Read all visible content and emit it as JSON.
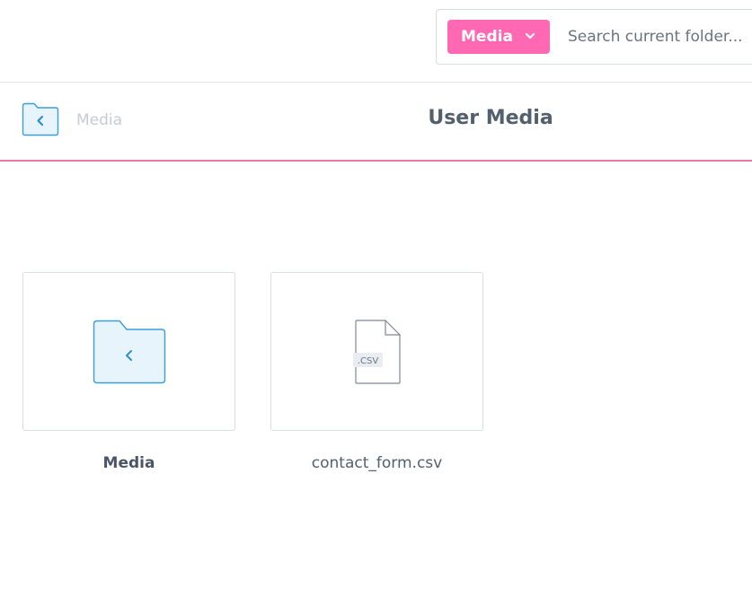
{
  "toolbar": {
    "scope_dropdown_label": "Media",
    "search_placeholder": "Search current folder..."
  },
  "header": {
    "breadcrumb_parent": "Media",
    "title": "User Media"
  },
  "items": [
    {
      "name": "Media",
      "type": "folder",
      "icon": "folder-back-icon"
    },
    {
      "name": "contact_form.csv",
      "type": "file",
      "icon": "csv-file-icon",
      "ext_badge": ".CSV"
    }
  ],
  "colors": {
    "accent": "#ff69b4",
    "folder_fill": "#e8f4fc",
    "folder_stroke": "#3a9fd6"
  }
}
